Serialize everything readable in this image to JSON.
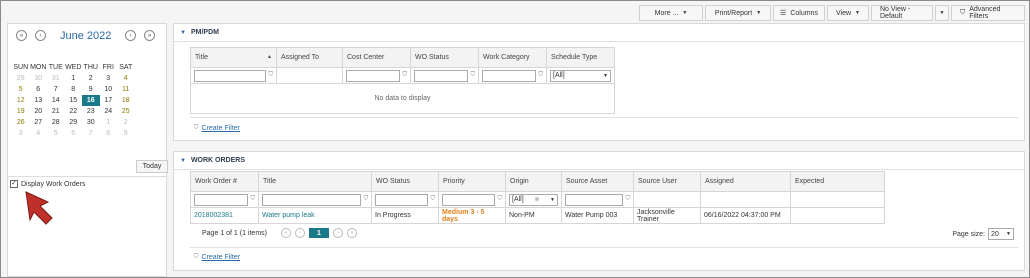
{
  "toolbar": {
    "more": "More ...",
    "print_report": "Print/Report",
    "columns": "Columns",
    "view": "View",
    "view_selector": "No View - Default",
    "advanced_filters": "Advanced Filters"
  },
  "calendar": {
    "month_label": "June 2022",
    "dow": [
      "SUN",
      "MON",
      "TUE",
      "WED",
      "THU",
      "FRI",
      "SAT"
    ],
    "weeks": [
      [
        "29",
        "30",
        "31",
        "1",
        "2",
        "3",
        "4"
      ],
      [
        "5",
        "6",
        "7",
        "8",
        "9",
        "10",
        "11"
      ],
      [
        "12",
        "13",
        "14",
        "15",
        "16",
        "17",
        "18"
      ],
      [
        "19",
        "20",
        "21",
        "22",
        "23",
        "24",
        "25"
      ],
      [
        "26",
        "27",
        "28",
        "29",
        "30",
        "1",
        "2"
      ],
      [
        "3",
        "4",
        "5",
        "6",
        "7",
        "8",
        "9"
      ]
    ],
    "selected_day": "16",
    "today_label": "Today"
  },
  "display_work_orders": {
    "label": "Display Work Orders",
    "checked": true
  },
  "pm_panel": {
    "title": "PM/PDM",
    "columns": [
      "Title",
      "Assigned To",
      "Cost Center",
      "WO Status",
      "Work Category",
      "Schedule Type"
    ],
    "schedule_type_filter": "[All]",
    "no_data": "No data to display",
    "create_filter": "Create Filter"
  },
  "wo_panel": {
    "title": "WORK ORDERS",
    "columns": [
      "Work Order #",
      "Title",
      "WO Status",
      "Priority",
      "Origin",
      "Source Asset",
      "Source User",
      "Assigned",
      "Expected"
    ],
    "origin_filter": "[All]",
    "row": {
      "work_order": "2018002381",
      "title": "Water pump leak",
      "status": "In Progress",
      "priority": "Medium 3 - 5 days",
      "origin": "Non-PM",
      "source_asset": "Water Pump 003",
      "source_user": "Jacksonville Trainer",
      "assigned": "06/16/2022 04:37:00 PM",
      "expected": ""
    },
    "pager_text": "Page 1 of 1 (1 items)",
    "current_page": "1",
    "page_size_label": "Page size:",
    "page_size": "20",
    "create_filter": "Create Filter"
  },
  "colors": {
    "accent": "#1a7a8a",
    "link": "#2a6aa6",
    "priority": "#e08020",
    "arrow": "#c0302a"
  }
}
